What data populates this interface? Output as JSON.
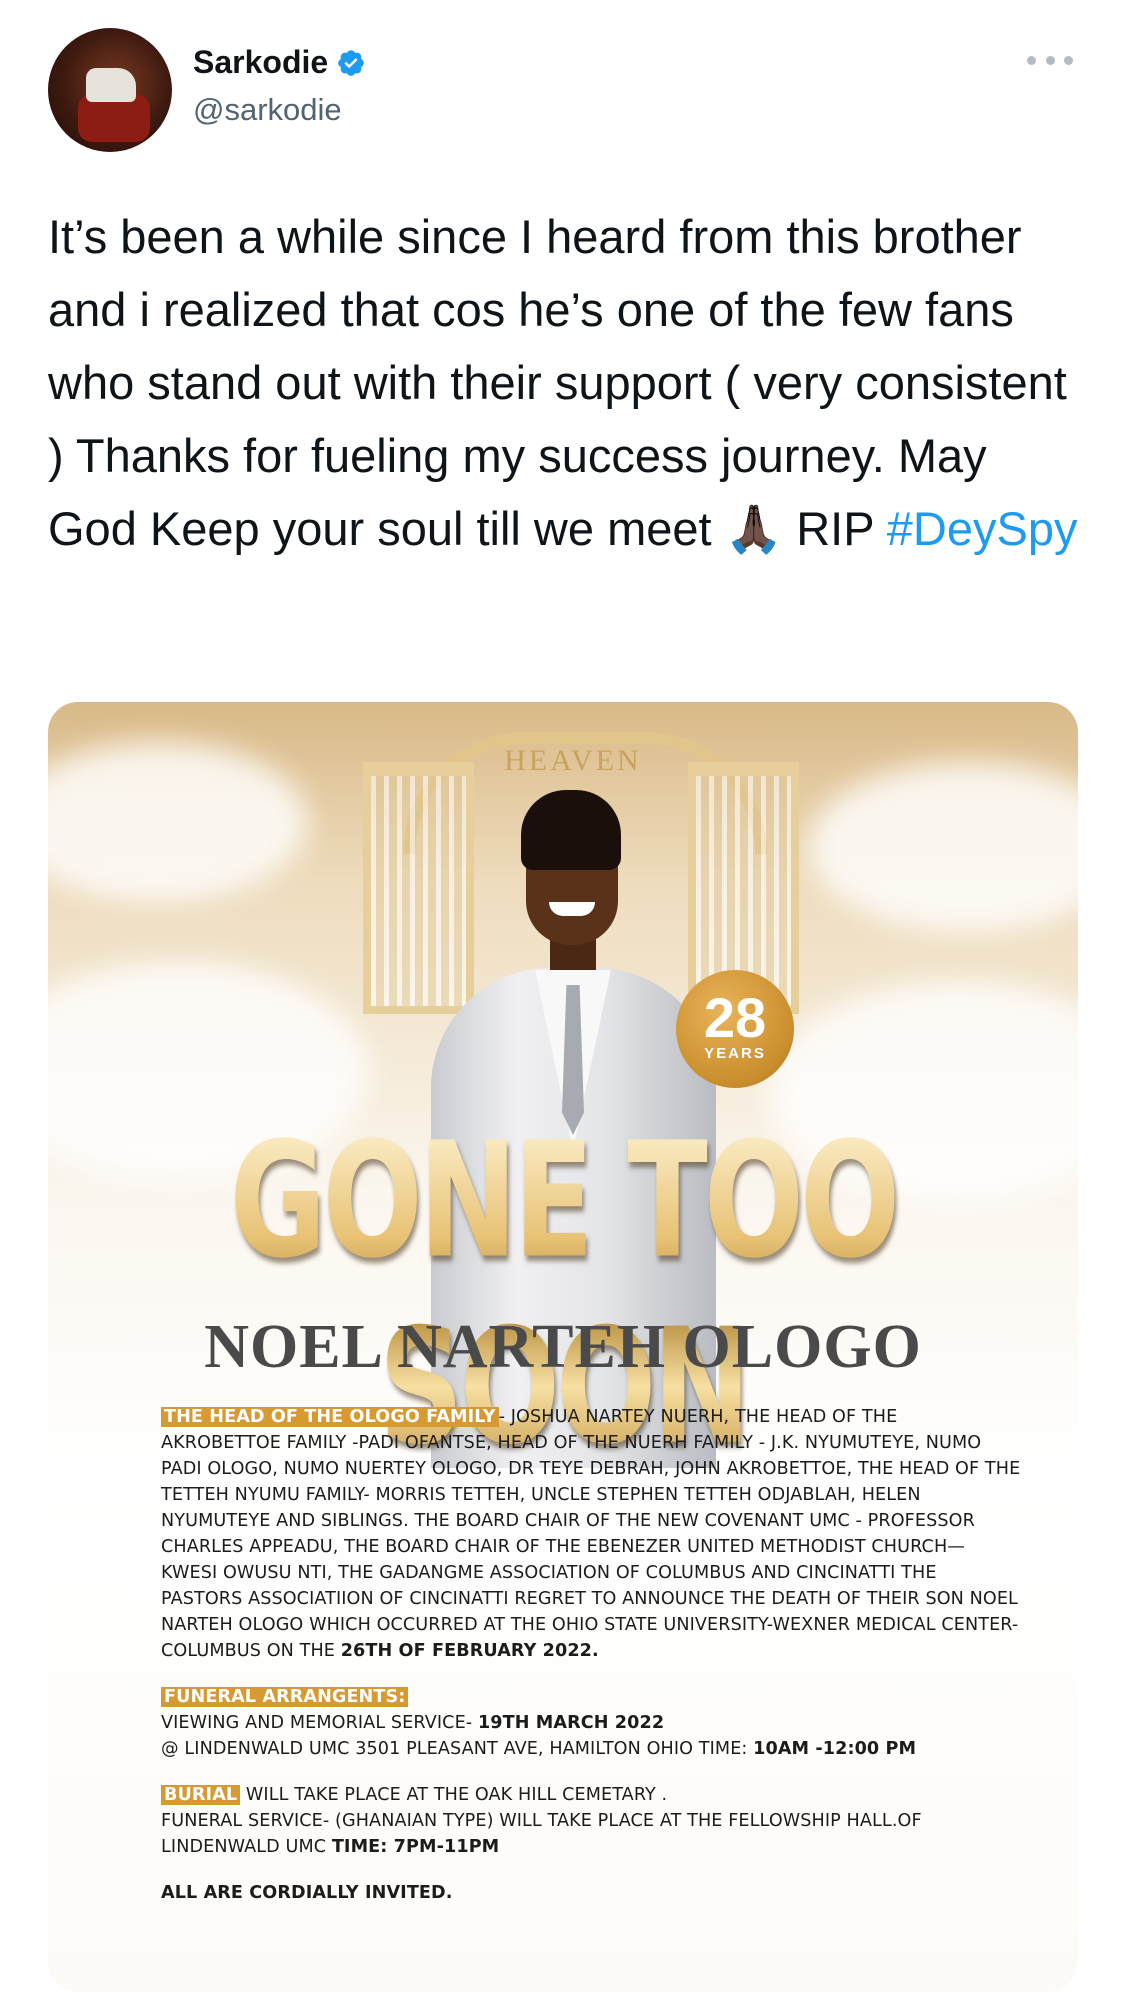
{
  "author": {
    "display_name": "Sarkodie",
    "handle": "@sarkodie",
    "verified_icon": "verified-badge-icon",
    "avatar": "profile-avatar"
  },
  "menu": {
    "icon": "more-options-icon"
  },
  "tweet": {
    "text": "It’s been a while since I heard from this brother and i realized that cos he’s one of the few fans who stand out with their support ( very consistent ) Thanks for fueling my success journey. May God Keep your soul till we meet 🙏🏿 RIP ",
    "hashtag": "#DeySpy"
  },
  "flyer": {
    "gate_text": "HEAVEN",
    "age": "28",
    "age_unit": "YEARS",
    "headline": "GONE TOO SOON",
    "name": "NOEL NARTEH OLOGO",
    "label_head": "THE HEAD OF THE OLOGO FAMILY",
    "notice_body": "- JOSHUA NARTEY NUERH,  THE HEAD OF THE AKROBETTOE FAMILY -PADI OFANTSE, HEAD OF THE NUERH FAMILY - J.K. NYUMUTEYE, NUMO PADI OLOGO, NUMO NUERTEY OLOGO, DR TEYE DEBRAH, JOHN AKROBETTOE, THE HEAD OF THE TETTEH NYUMU FAMILY- MORRIS TETTEH, UNCLE STEPHEN TETTEH ODJABLAH, HELEN NYUMUTEYE AND SIBLINGS. THE BOARD CHAIR OF THE NEW COVENANT UMC - PROFESSOR CHARLES APPEADU, THE BOARD CHAIR OF THE EBENEZER UNITED METHODIST CHURCH—KWESI OWUSU NTI, THE GADANGME ASSOCIATION OF COLUMBUS AND CINCINATTI THE PASTORS ASSOCIATIION OF CINCINATTI REGRET TO ANNOUNCE THE DEATH OF THEIR SON NOEL NARTEH OLOGO WHICH OCCURRED AT THE OHIO STATE UNIVERSITY-WEXNER MEDICAL CENTER- COLUMBUS ON THE ",
    "death_date": "26TH OF FEBRUARY 2022.",
    "label_funeral": "FUNERAL ARRANGENTS:",
    "viewing_line": "VIEWING AND MEMORIAL SERVICE- ",
    "viewing_date": "19TH MARCH 2022",
    "venue_line": "@ LINDENWALD UMC 3501 PLEASANT AVE, HAMILTON OHIO  TIME: ",
    "venue_time": "10AM -12:00 PM",
    "label_burial": "BURIAL",
    "burial_line": " WILL TAKE PLACE AT THE OAK HILL CEMETARY .",
    "service_line": "FUNERAL SERVICE- (GHANAIAN TYPE) WILL TAKE PLACE  AT THE FELLOWSHIP HALL.OF LINDENWALD UMC ",
    "service_time": "TIME: 7PM-11PM",
    "closing": "ALL ARE CORDIALLY INVITED."
  },
  "colors": {
    "hashtag": "#1d9bf0",
    "verified": "#1d9bf0",
    "highlight": "#d79a32",
    "headline_gold": "#d6ad5a"
  }
}
